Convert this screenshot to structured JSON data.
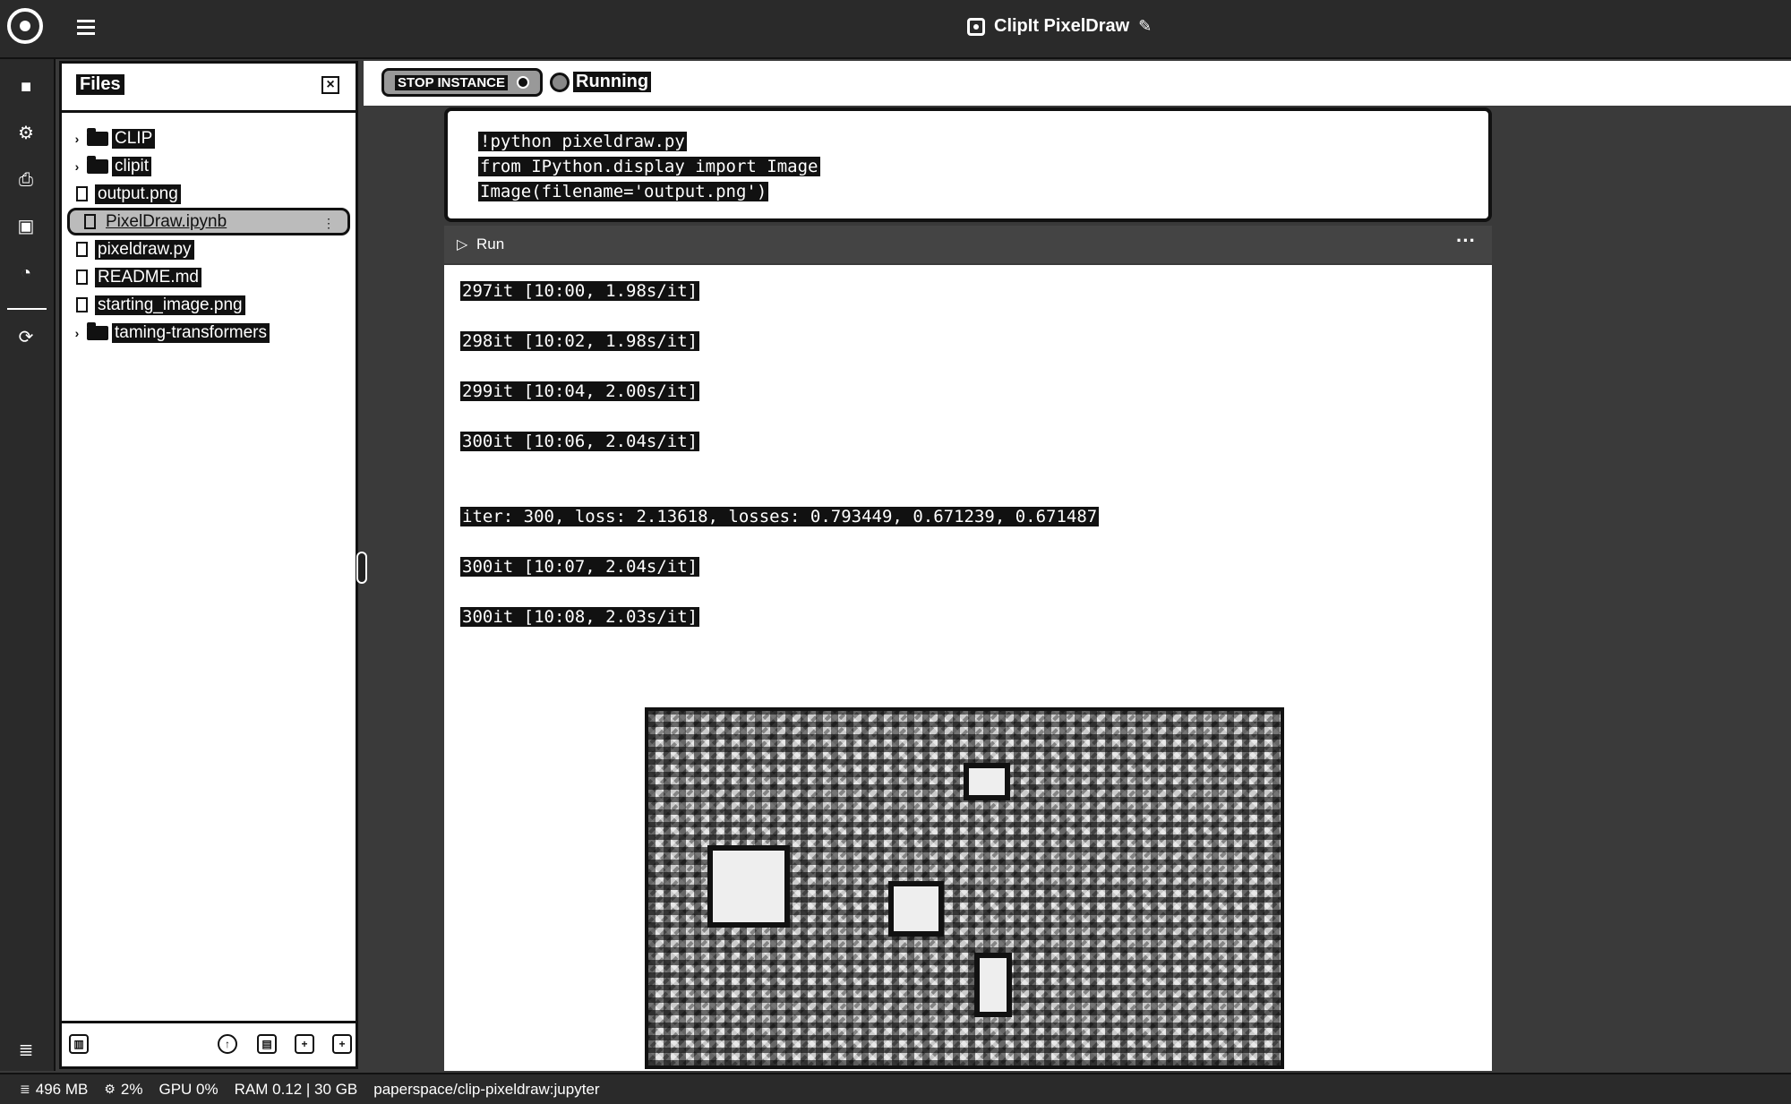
{
  "header": {
    "app_title": "ClipIt PixelDraw",
    "edit_icon": "edit-icon",
    "menu_icon": "hamburger-icon",
    "logo": "paperspace-logo"
  },
  "left_nav": {
    "icons": [
      "folder-icon",
      "gear-icon",
      "notebook-icon",
      "terminal-icon",
      "clock-icon",
      "refresh-icon",
      "database-icon"
    ]
  },
  "files": {
    "title": "Files",
    "items": [
      {
        "name": "CLIP",
        "type": "folder"
      },
      {
        "name": "clipit",
        "type": "folder"
      },
      {
        "name": "output.png",
        "type": "file"
      },
      {
        "name": "PixelDraw.ipynb",
        "type": "notebook",
        "selected": true
      },
      {
        "name": "pixeldraw.py",
        "type": "file"
      },
      {
        "name": "README.md",
        "type": "file"
      },
      {
        "name": "starting_image.png",
        "type": "file"
      },
      {
        "name": "taming-transformers",
        "type": "folder"
      }
    ],
    "footer_icons": [
      "trash-icon",
      "upload-icon",
      "new-notebook-icon",
      "new-file-icon",
      "new-folder-icon"
    ]
  },
  "toolbar": {
    "stop_label": "STOP INSTANCE",
    "status": "Running"
  },
  "cell": {
    "code": [
      "!python pixeldraw.py",
      "from IPython.display import Image",
      "Image(filename='output.png')"
    ],
    "run_label": "Run",
    "more": "···"
  },
  "output": {
    "lines": [
      "297it [10:00,  1.98s/it]",
      "298it [10:02,  1.98s/it]",
      "299it [10:04,  2.00s/it]",
      "300it [10:06,  2.04s/it]",
      "iter: 300, loss: 2.13618, losses: 0.793449, 0.671239, 0.671487",
      "300it [10:07,  2.04s/it]",
      "300it [10:08,  2.03s/it]"
    ]
  },
  "statusbar": {
    "storage": "496 MB",
    "cpu": "2%",
    "gpu": "GPU 0%",
    "ram": "RAM 0.12 | 30 GB",
    "path": "paperspace/clip-pixeldraw:jupyter"
  }
}
